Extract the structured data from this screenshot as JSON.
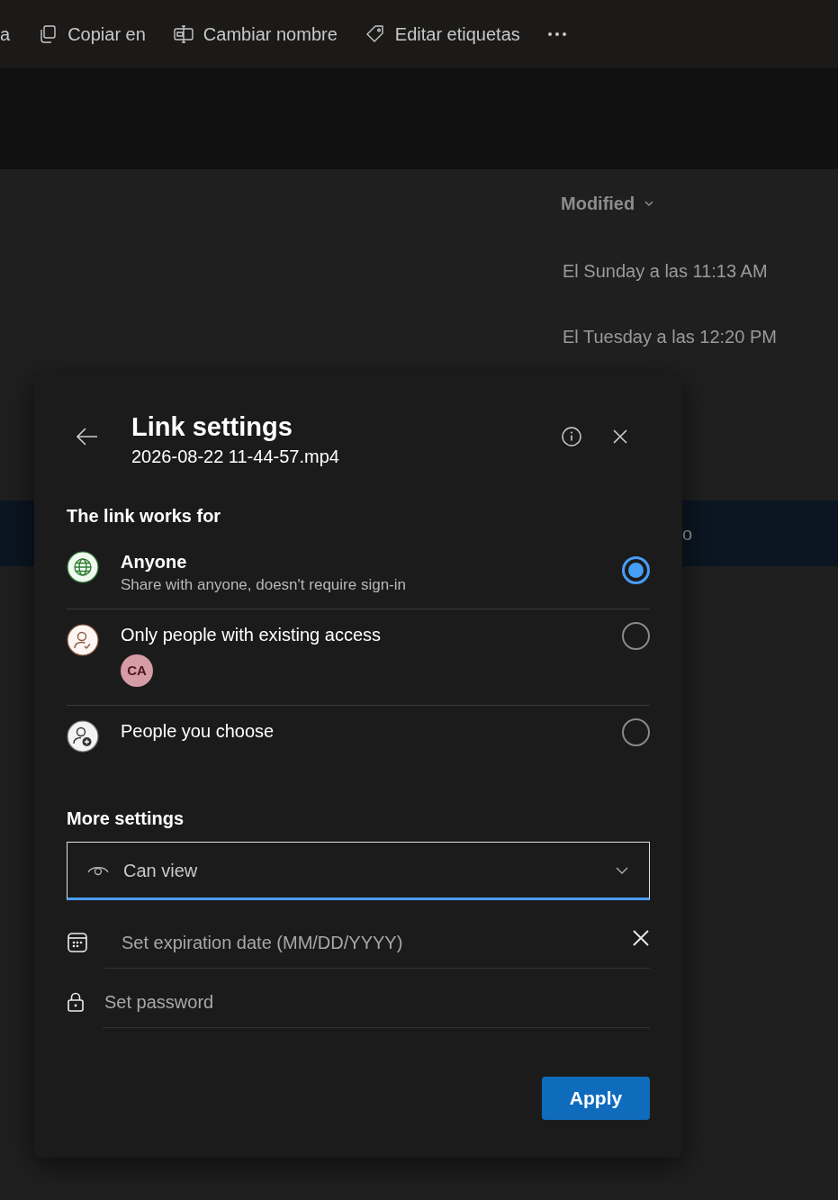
{
  "toolbar": {
    "items": [
      {
        "label": "a",
        "kind": "none"
      },
      {
        "label": "Copiar en",
        "kind": "copy"
      },
      {
        "label": "Cambiar nombre",
        "kind": "rename"
      },
      {
        "label": "Editar etiquetas",
        "kind": "tag"
      }
    ]
  },
  "file_list": {
    "column_header": "Modified",
    "rows": [
      {
        "kind": "date",
        "text": "El Sunday a las 11:13 AM",
        "selected": false
      },
      {
        "kind": "date",
        "text": "El Tuesday a las 12:20 PM",
        "selected": false
      },
      {
        "kind": "name",
        "text": "o",
        "selected": true
      }
    ]
  },
  "dialog": {
    "title": "Link settings",
    "subtitle": "2026-08-22 11-44-57.mp4",
    "section_label": "The link works for",
    "options": [
      {
        "kind": "globe",
        "label": "Anyone",
        "description": "Share with anyone, doesn't require sign-in",
        "selected": true
      },
      {
        "kind": "existing",
        "label": "Only people with existing access",
        "avatar": "CA",
        "selected": false
      },
      {
        "kind": "choose",
        "label": "People you choose",
        "selected": false
      }
    ],
    "more_settings_label": "More settings",
    "permission": {
      "value": "Can view",
      "focused": true
    },
    "expiration": {
      "placeholder": "Set expiration date (MM/DD/YYYY)"
    },
    "password": {
      "placeholder": "Set password"
    },
    "apply": "Apply"
  }
}
